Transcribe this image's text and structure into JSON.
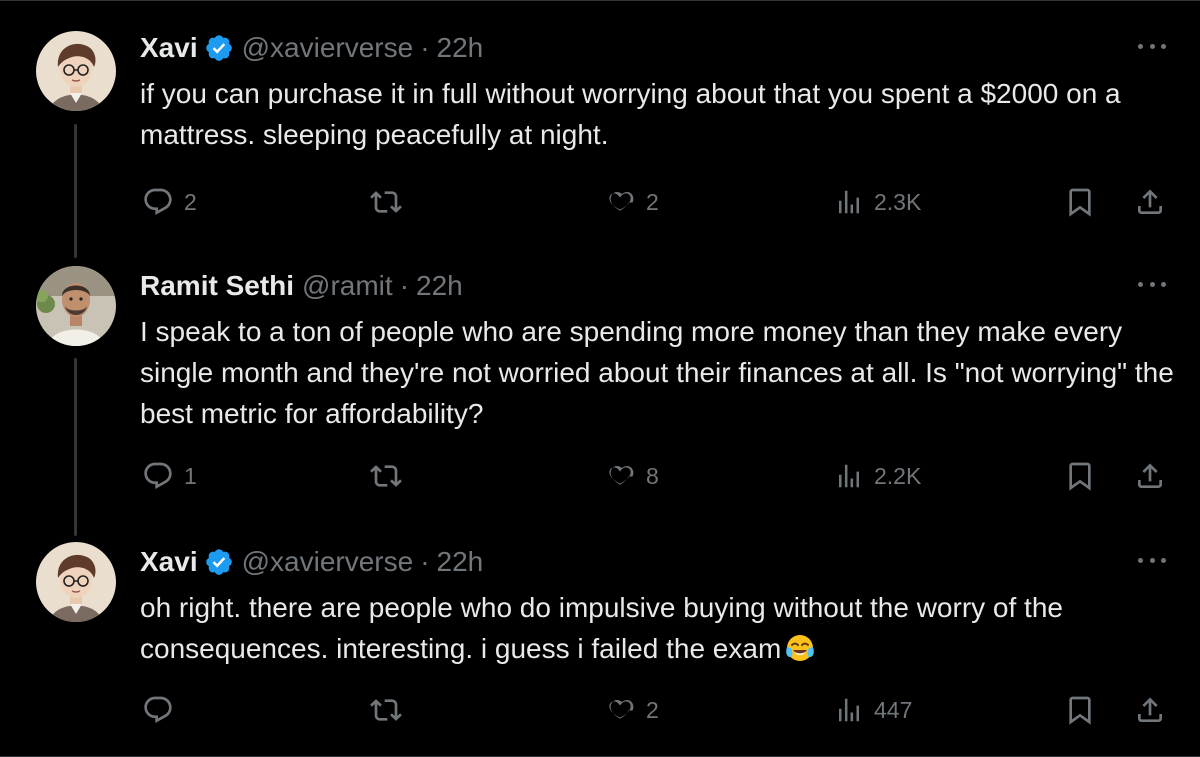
{
  "tweets": [
    {
      "display_name": "Xavi",
      "verified": true,
      "handle": "@xavierverse",
      "separator": "·",
      "time": "22h",
      "text": "if you can purchase it in full without worrying about that you spent a $2000 on a mattress. sleeping peacefully at night.",
      "emoji": "",
      "replies": "2",
      "reposts": "",
      "likes": "2",
      "views": "2.3K",
      "avatar": "cartoon-avatar"
    },
    {
      "display_name": "Ramit Sethi",
      "verified": false,
      "handle": "@ramit",
      "separator": "·",
      "time": "22h",
      "text": "I speak to a ton of people who are spending more money than they make every single month and they're not worried about their finances at all. Is \"not worrying\" the best metric for affordability?",
      "emoji": "",
      "replies": "1",
      "reposts": "",
      "likes": "8",
      "views": "2.2K",
      "avatar": "photo-avatar"
    },
    {
      "display_name": "Xavi",
      "verified": true,
      "handle": "@xavierverse",
      "separator": "·",
      "time": "22h",
      "text": "oh right. there are people who do impulsive buying without the worry of the consequences. interesting.  i guess i failed the exam",
      "emoji": "face-with-tears-of-joy",
      "replies": "",
      "reposts": "",
      "likes": "2",
      "views": "447",
      "avatar": "cartoon-avatar"
    }
  ],
  "colors": {
    "background": "#000000",
    "text": "#e7e9ea",
    "muted": "#71767b",
    "verified": "#1d9bf0",
    "thread_line": "#333639"
  },
  "icons": [
    "reply-icon",
    "repost-icon",
    "like-icon",
    "views-icon",
    "bookmark-icon",
    "share-icon",
    "more-icon",
    "verified-badge-icon"
  ]
}
